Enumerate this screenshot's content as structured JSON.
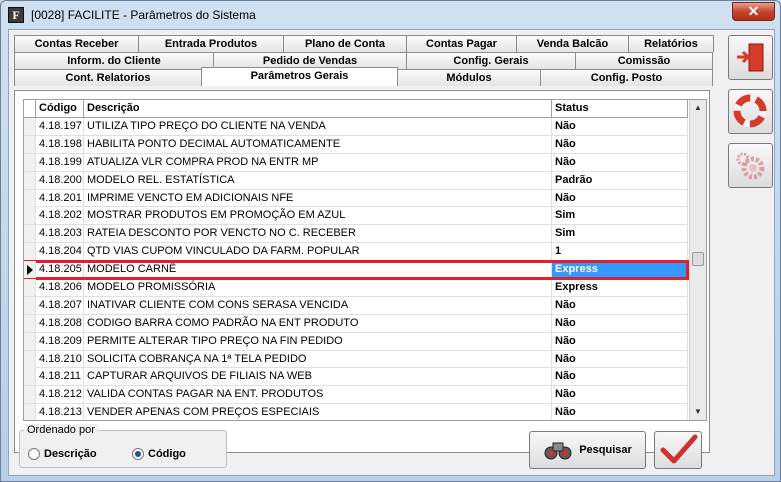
{
  "window": {
    "title": "[0028] FACILITE - Parâmetros do Sistema",
    "app_icon_letter": "F",
    "close_glyph": "✕"
  },
  "tabs": {
    "row1": [
      "Contas Receber",
      "Entrada Produtos",
      "Plano de Conta",
      "Contas Pagar",
      "Venda Balcão",
      "Relatórios"
    ],
    "row2": [
      "Inform. do Cliente",
      "Pedido de Vendas",
      "Config. Gerais",
      "Comissão"
    ],
    "row3": [
      "Cont. Relatorios",
      "Parâmetros Gerais",
      "Módulos",
      "Config. Posto"
    ],
    "active": "Parâmetros Gerais"
  },
  "grid": {
    "columns": [
      "Código",
      "Descrição",
      "Status"
    ],
    "rows": [
      {
        "code": "4.18.197",
        "desc": "UTILIZA TIPO PREÇO DO CLIENTE NA VENDA",
        "status": "Não"
      },
      {
        "code": "4.18.198",
        "desc": "HABILITA PONTO DECIMAL AUTOMATICAMENTE",
        "status": "Não"
      },
      {
        "code": "4.18.199",
        "desc": "ATUALIZA VLR COMPRA PROD NA ENTR MP",
        "status": "Não"
      },
      {
        "code": "4.18.200",
        "desc": "MODELO REL. ESTATÍSTICA",
        "status": "Padrão"
      },
      {
        "code": "4.18.201",
        "desc": "IMPRIME VENCTO EM ADICIONAIS NFE",
        "status": "Não"
      },
      {
        "code": "4.18.202",
        "desc": "MOSTRAR PRODUTOS EM PROMOÇÃO EM AZUL",
        "status": "Sim"
      },
      {
        "code": "4.18.203",
        "desc": "RATEIA DESCONTO POR VENCTO NO C. RECEBER",
        "status": "Sim"
      },
      {
        "code": "4.18.204",
        "desc": "QTD VIAS CUPOM VINCULADO DA FARM. POPULAR",
        "status": "1"
      },
      {
        "code": "4.18.205",
        "desc": "MODELO CARNÊ",
        "status": "Express",
        "selected": true
      },
      {
        "code": "4.18.206",
        "desc": "MODELO PROMISSÓRIA",
        "status": "Express"
      },
      {
        "code": "4.18.207",
        "desc": "INATIVAR CLIENTE COM CONS SERASA VENCIDA",
        "status": "Não"
      },
      {
        "code": "4.18.208",
        "desc": "CODIGO BARRA COMO PADRÃO NA ENT PRODUTO",
        "status": "Não"
      },
      {
        "code": "4.18.209",
        "desc": "PERMITE ALTERAR TIPO PREÇO NA FIN PEDIDO",
        "status": "Não"
      },
      {
        "code": "4.18.210",
        "desc": "SOLICITA COBRANÇA NA 1ª TELA PEDIDO",
        "status": "Não"
      },
      {
        "code": "4.18.211",
        "desc": "CAPTURAR ARQUIVOS DE FILIAIS NA WEB",
        "status": "Não"
      },
      {
        "code": "4.18.212",
        "desc": "VALIDA CONTAS PAGAR NA ENT. PRODUTOS",
        "status": "Não"
      },
      {
        "code": "4.18.213",
        "desc": "VENDER APENAS COM PREÇOS ESPECIAIS",
        "status": "Não"
      }
    ]
  },
  "order": {
    "legend": "Ordenado por",
    "options": [
      "Descrição",
      "Código"
    ],
    "selected": "Código"
  },
  "buttons": {
    "search_label": "Pesquisar"
  },
  "colors": {
    "selection": "#3399ff",
    "highlight_border": "#e0202a",
    "exit_icon": "#d63a2a"
  }
}
